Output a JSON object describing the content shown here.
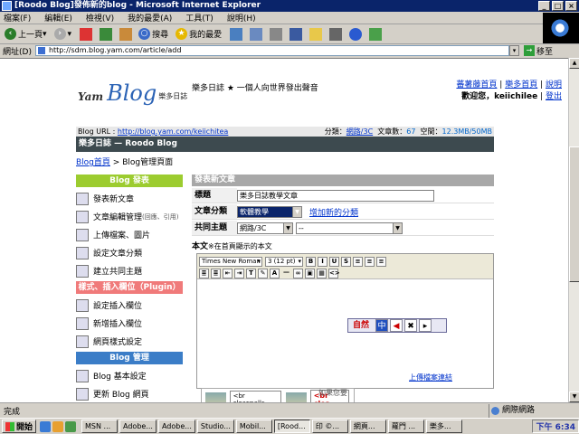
{
  "window": {
    "title": "[Roodo Blog]發佈新的blog - Microsoft Internet Explorer",
    "buttons": [
      "_",
      "□",
      "×"
    ]
  },
  "menu": [
    "檔案(F)",
    "編輯(E)",
    "檢視(V)",
    "我的最愛(A)",
    "工具(T)",
    "說明(H)"
  ],
  "toolbar": {
    "back": "上一頁",
    "search": "搜尋",
    "favorites": "我的最愛"
  },
  "address": {
    "label": "網址(D)",
    "url": "http://sdm.blog.yam.com/article/add",
    "go": "移至"
  },
  "site": {
    "brand_yam": "Yam",
    "brand_blog": "Blog",
    "brand_sub": "樂多日誌",
    "slogan": "樂多日誌 ★ 一個人向世界發出聲音",
    "links": [
      "蕃薯藤首頁",
      "樂多首頁",
      "說明"
    ],
    "welcome": "歡迎您，keiichilee",
    "logout": "登出"
  },
  "bloginfo": {
    "url_label": "Blog URL :",
    "url": "http://blog.yam.com/keiichitea",
    "category_label": "分類：",
    "category": "網路/3C",
    "count_label": "文章數：",
    "count": "67",
    "space_label": "空間：",
    "space": "12.3MB/50MB"
  },
  "blog_title": "樂多日誌 — Roodo Blog",
  "breadcrumb": {
    "home": "Blog首頁",
    "sep": ">",
    "current": "Blog管理頁面"
  },
  "sidebar": {
    "sec1": "Blog 發表",
    "items1": [
      {
        "label": "發表新文章",
        "small": ""
      },
      {
        "label": "文章編輯管理",
        "small": "(回應、引用)"
      },
      {
        "label": "上傳檔案、圖片",
        "small": ""
      },
      {
        "label": "設定文章分類",
        "small": ""
      },
      {
        "label": "建立共同主題",
        "small": ""
      }
    ],
    "sec2": "樣式、插入欄位（Plugin）",
    "items2": [
      {
        "label": "設定插入欄位"
      },
      {
        "label": "新增插入欄位"
      },
      {
        "label": "網頁樣式設定"
      }
    ],
    "sec3": "Blog 管理",
    "items3": [
      {
        "label": "Blog 基本設定"
      },
      {
        "label": "更新 Blog 網頁"
      }
    ]
  },
  "form": {
    "heading": "發表新文章",
    "title_label": "標題",
    "title_value": "樂多日誌教學文章",
    "category_label": "文章分類",
    "category_value": "軟體教學",
    "add_category": "增加新的分類",
    "topic_label": "共同主題",
    "topic_value": "網路/3C",
    "topic_value2": "--",
    "body_label": "本文",
    "body_hint": "※在首頁顯示的本文"
  },
  "editor": {
    "font": "Times New Roman",
    "size": "3 (12 pt)",
    "row1": [
      "B",
      "I",
      "U",
      "S"
    ],
    "attach_tag": "<br clear=all>",
    "attach_tag_red": "<br clea",
    "attach_hint": "如果您要",
    "more_link": "上傳檔案連結"
  },
  "ime": {
    "logo": "自然",
    "mode": "中"
  },
  "status": {
    "text": "完成",
    "zone": "網際網路"
  },
  "taskbar": {
    "start": "開始",
    "tasks": [
      "MSN ...",
      "Adobe...",
      "Adobe...",
      "Studio...",
      "Mobil...",
      "[Rood...",
      "印 ©...",
      "網頁...",
      "蘿門 ...",
      "樂多..."
    ],
    "clock": "下午 6:34"
  }
}
